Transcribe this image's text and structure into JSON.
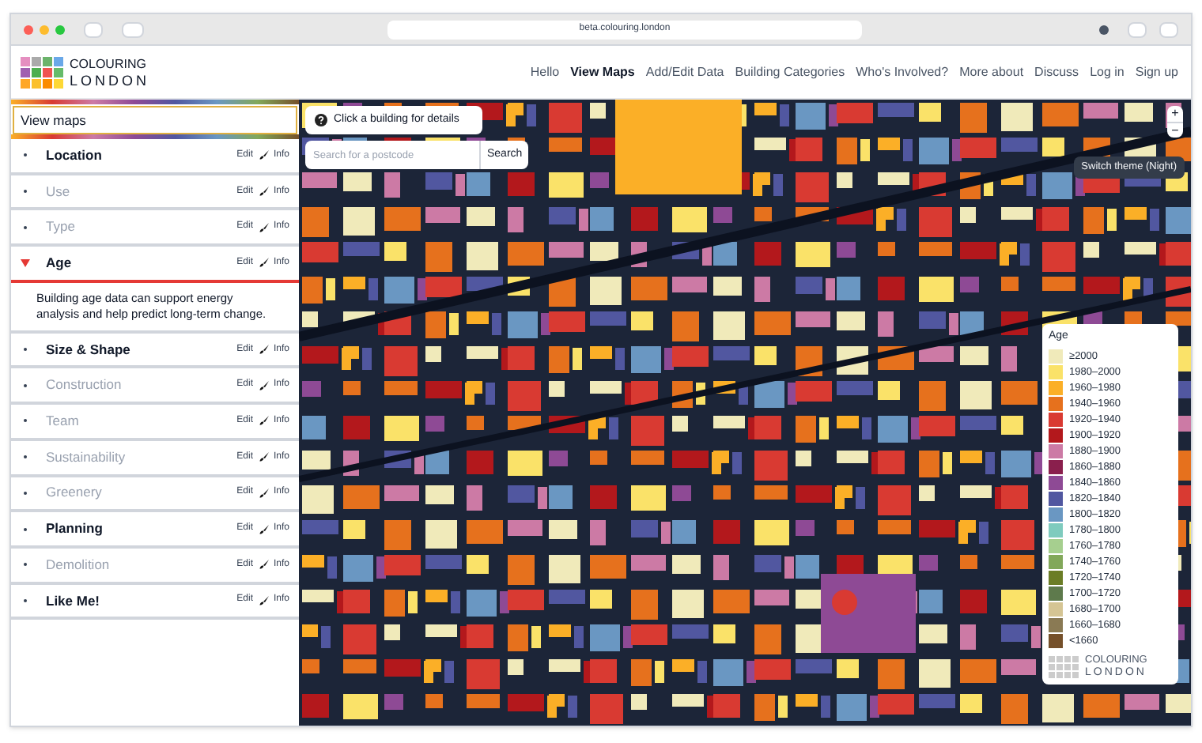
{
  "browser": {
    "url": "beta.colouring.london"
  },
  "logo": {
    "line_1": "COLOURING",
    "line_2": "LONDON"
  },
  "nav": [
    {
      "label": "Hello",
      "selected": false
    },
    {
      "label": "View Maps",
      "selected": true
    },
    {
      "label": "Add/Edit Data",
      "selected": false
    },
    {
      "label": "Building Categories",
      "selected": false
    },
    {
      "label": "Who's Involved?",
      "selected": false
    },
    {
      "label": "More about",
      "selected": false
    },
    {
      "label": "Discuss",
      "selected": false
    },
    {
      "label": "Log in",
      "selected": false
    },
    {
      "label": "Sign up",
      "selected": false
    }
  ],
  "sidebar": {
    "title": "View maps",
    "items": [
      {
        "label": "Location",
        "disabled": false,
        "expanded": false,
        "edit": "Edit",
        "info": "Info"
      },
      {
        "label": "Use",
        "disabled": true,
        "expanded": false,
        "edit": "Edit",
        "info": "Info"
      },
      {
        "label": "Type",
        "disabled": true,
        "expanded": false,
        "edit": "Edit",
        "info": "Info"
      },
      {
        "label": "Age",
        "disabled": false,
        "expanded": true,
        "edit": "Edit",
        "info": "Info",
        "description": "Building age data can support energy analysis and help predict long-term change."
      },
      {
        "label": "Size & Shape",
        "disabled": false,
        "expanded": false,
        "edit": "Edit",
        "info": "Info"
      },
      {
        "label": "Construction",
        "disabled": true,
        "expanded": false,
        "edit": "Edit",
        "info": "Info"
      },
      {
        "label": "Team",
        "disabled": true,
        "expanded": false,
        "edit": "Edit",
        "info": "Info"
      },
      {
        "label": "Sustainability",
        "disabled": true,
        "expanded": false,
        "edit": "Edit",
        "info": "Info"
      },
      {
        "label": "Greenery",
        "disabled": true,
        "expanded": false,
        "edit": "Edit",
        "info": "Info"
      },
      {
        "label": "Planning",
        "disabled": false,
        "expanded": false,
        "edit": "Edit",
        "info": "Info"
      },
      {
        "label": "Demolition",
        "disabled": true,
        "expanded": false,
        "edit": "Edit",
        "info": "Info"
      },
      {
        "label": "Like Me!",
        "disabled": false,
        "expanded": false,
        "edit": "Edit",
        "info": "Info"
      }
    ]
  },
  "map": {
    "help": "Click a building for details",
    "search": {
      "placeholder": "Search for a postcode",
      "button": "Search"
    },
    "zoom_in": "+",
    "zoom_out": "−",
    "theme_button": "Switch theme (Night)"
  },
  "legend": {
    "title": "Age",
    "items": [
      {
        "label": "≥2000",
        "color": "#f0eaba"
      },
      {
        "label": "1980–2000",
        "color": "#fae269"
      },
      {
        "label": "1960–1980",
        "color": "#fbaf27"
      },
      {
        "label": "1940–1960",
        "color": "#e6711d"
      },
      {
        "label": "1920–1940",
        "color": "#d93a32"
      },
      {
        "label": "1900–1920",
        "color": "#b3181c"
      },
      {
        "label": "1880–1900",
        "color": "#cc7aa5"
      },
      {
        "label": "1860–1880",
        "color": "#8a1f4d"
      },
      {
        "label": "1840–1860",
        "color": "#8e4a95"
      },
      {
        "label": "1820–1840",
        "color": "#5157a0"
      },
      {
        "label": "1800–1820",
        "color": "#6a97c2"
      },
      {
        "label": "1780–1800",
        "color": "#7fcbbe"
      },
      {
        "label": "1760–1780",
        "color": "#a6cf8f"
      },
      {
        "label": "1740–1760",
        "color": "#82a85a"
      },
      {
        "label": "1720–1740",
        "color": "#6b7d26"
      },
      {
        "label": "1700–1720",
        "color": "#5e7a4c"
      },
      {
        "label": "1680–1700",
        "color": "#d5c594"
      },
      {
        "label": "1660–1680",
        "color": "#8a7a54"
      },
      {
        "label": "<1660",
        "color": "#75502a"
      }
    ],
    "logo_line_1": "COLOURING",
    "logo_line_2": "LONDON"
  }
}
